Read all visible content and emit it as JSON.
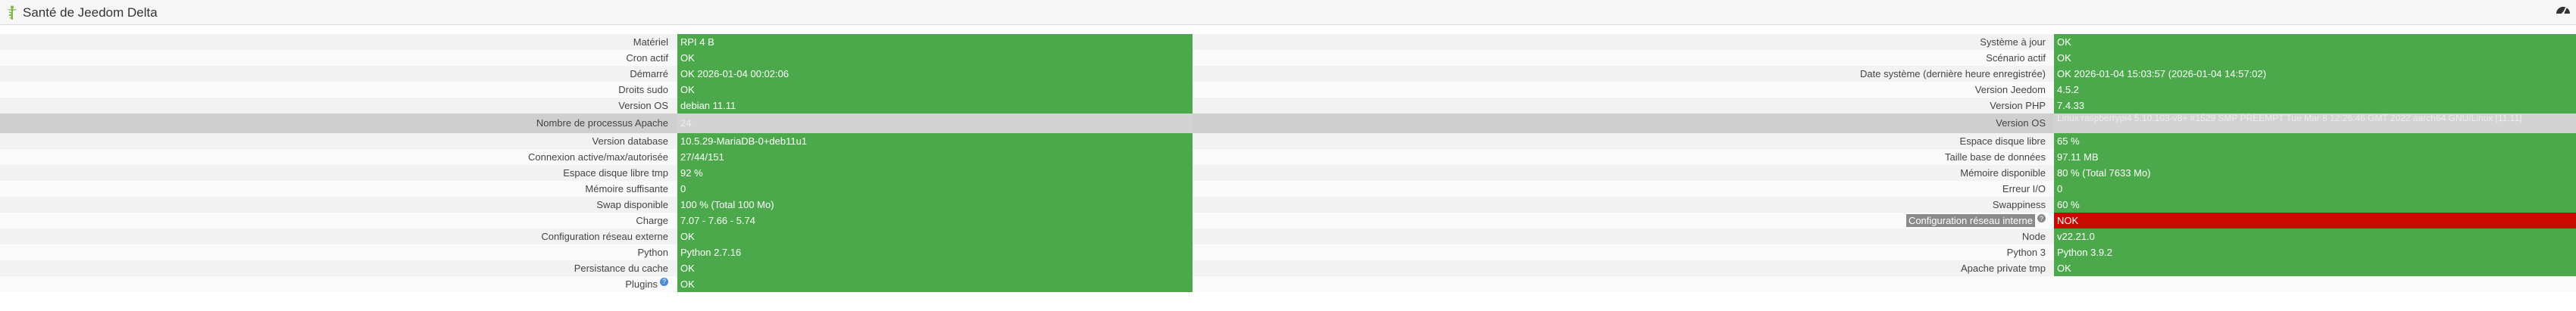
{
  "header": {
    "title": "Santé de Jeedom Delta",
    "icon": "caduceus-icon",
    "right_icon": "gauge-icon"
  },
  "colors": {
    "ok": "#4ca94b",
    "nok": "#c70b00",
    "accent": "#4a8ad6"
  },
  "rows": [
    {
      "left_label": "Matériel",
      "left_value": "RPI 4 B",
      "left_status": "ok",
      "right_label": "Système à jour",
      "right_value": "OK",
      "right_status": "ok"
    },
    {
      "left_label": "Cron actif",
      "left_value": "OK",
      "left_status": "ok",
      "right_label": "Scénario actif",
      "right_value": "OK",
      "right_status": "ok"
    },
    {
      "left_label": "Démarré",
      "left_value": "OK 2026-01-04 00:02:06",
      "left_status": "ok",
      "right_label": "Date système (dernière heure enregistrée)",
      "right_value": "OK 2026-01-04 15:03:57 (2026-01-04 14:57:02)",
      "right_status": "ok"
    },
    {
      "left_label": "Droits sudo",
      "left_value": "OK",
      "left_status": "ok",
      "right_label": "Version Jeedom",
      "right_value": "4.5.2",
      "right_status": "ok"
    },
    {
      "left_label": "Version OS",
      "left_value": "debian 11.11",
      "left_status": "ok",
      "right_label": "Version PHP",
      "right_value": "7.4.33",
      "right_status": "ok"
    },
    {
      "left_label": "Nombre de processus Apache",
      "left_value": "24",
      "left_status": "faint",
      "right_label": "Version OS",
      "right_value": "Linux raspberrypi4 5.10.103-v8+ #1529 SMP PREEMPT Tue Mar 8 12:26:46 GMT 2022 aarch64 GNU/Linux [11.11]",
      "right_status": "faint"
    },
    {
      "left_label": "Version database",
      "left_value": "10.5.29-MariaDB-0+deb11u1",
      "left_status": "ok",
      "right_label": "Espace disque libre",
      "right_value": "65 %",
      "right_status": "ok"
    },
    {
      "left_label": "Connexion active/max/autorisée",
      "left_value": "27/44/151",
      "left_status": "ok",
      "right_label": "Taille base de données",
      "right_value": "97.11 MB",
      "right_status": "ok"
    },
    {
      "left_label": "Espace disque libre tmp",
      "left_value": "92 %",
      "left_status": "ok",
      "right_label": "Mémoire disponible",
      "right_value": "80 % (Total 7633 Mo)",
      "right_status": "ok"
    },
    {
      "left_label": "Mémoire suffisante",
      "left_value": "0",
      "left_status": "ok",
      "right_label": "Erreur I/O",
      "right_value": "0",
      "right_status": "ok"
    },
    {
      "left_label": "Swap disponible",
      "left_value": "100 % (Total 100 Mo)",
      "left_status": "ok",
      "right_label": "Swappiness",
      "right_value": "60 %",
      "right_status": "ok"
    },
    {
      "left_label": "Charge",
      "left_value": "7.07 - 7.66 - 5.74",
      "left_status": "ok",
      "right_label": "Configuration réseau interne",
      "right_value": "NOK",
      "right_status": "nok"
    },
    {
      "left_label": "Configuration réseau externe",
      "left_value": "OK",
      "left_status": "ok",
      "right_label": "Node",
      "right_value": "v22.21.0",
      "right_status": "ok"
    },
    {
      "left_label": "Python",
      "left_value": "Python 2.7.16",
      "left_status": "ok",
      "right_label": "Python 3",
      "right_value": "Python 3.9.2",
      "right_status": "ok"
    },
    {
      "left_label": "Persistance du cache",
      "left_value": "OK",
      "left_status": "ok",
      "right_label": "Apache private tmp",
      "right_value": "OK",
      "right_status": "ok"
    },
    {
      "left_label": "Plugins",
      "left_value": "OK",
      "left_status": "ok",
      "right_label": "",
      "right_value": "",
      "right_status": "none"
    }
  ]
}
